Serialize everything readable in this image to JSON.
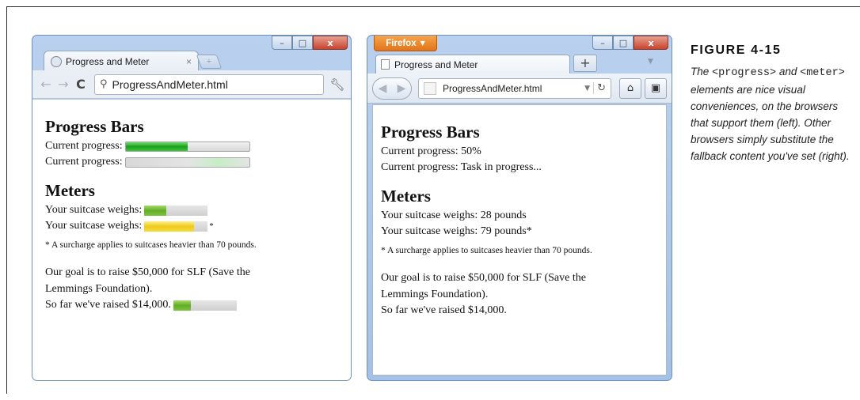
{
  "chrome_window": {
    "tab_title": "Progress and Meter",
    "tab_close": "×",
    "address": "ProgressAndMeter.html",
    "controls": {
      "minimize": "–",
      "maximize": "□",
      "close": "x"
    }
  },
  "firefox_window": {
    "menu_button": "Firefox",
    "tab_title": "Progress and Meter",
    "new_tab": "+",
    "address": "ProgressAndMeter.html",
    "controls": {
      "minimize": "–",
      "maximize": "□",
      "close": "x"
    }
  },
  "page": {
    "progress_heading": "Progress Bars",
    "progress_label": "Current progress:",
    "meters_heading": "Meters",
    "meter_label": "Your suitcase weighs:",
    "asterisk": "*",
    "surcharge_note": "* A surcharge applies to suitcases heavier than 70 pounds.",
    "goal_text": "Our goal is to raise $50,000 for SLF (Save the Lemmings Foundation).",
    "raised_text": "So far we've raised $14,000."
  },
  "chrome_page_values": {
    "progress_fraction": 0.5,
    "meter1_fraction": 0.35,
    "meter2_fraction": 0.79,
    "fundraising_fraction": 0.28
  },
  "firefox_page": {
    "progress_line_1": "Current progress: 50%",
    "progress_line_2": "Current progress: Task in progress...",
    "meter_line_1": "Your suitcase weighs: 28 pounds",
    "meter_line_2": "Your suitcase weighs: 79 pounds*",
    "raised_line": "So far we've raised $14,000."
  },
  "caption": {
    "title": "FIGURE 4-15",
    "text_the": "The",
    "code_progress": "<progress>",
    "text_and": "and",
    "code_meter": "<meter>",
    "text_rest": "elements are nice visual conveniences, on the browsers that support them (left). Other browsers simply substitute the fallback content you've set (right)."
  },
  "colors": {
    "progress_green": "#1aa01a",
    "meter_green": "#63ad25",
    "meter_yellow": "#eecb1c",
    "firefox_orange": "#e1751a",
    "window_frame": "#a4c1e6"
  },
  "icons": [
    "back-arrow-icon",
    "forward-arrow-icon",
    "reload-icon",
    "search-icon",
    "wrench-icon",
    "home-icon",
    "bookmarks-icon",
    "page-icon"
  ]
}
